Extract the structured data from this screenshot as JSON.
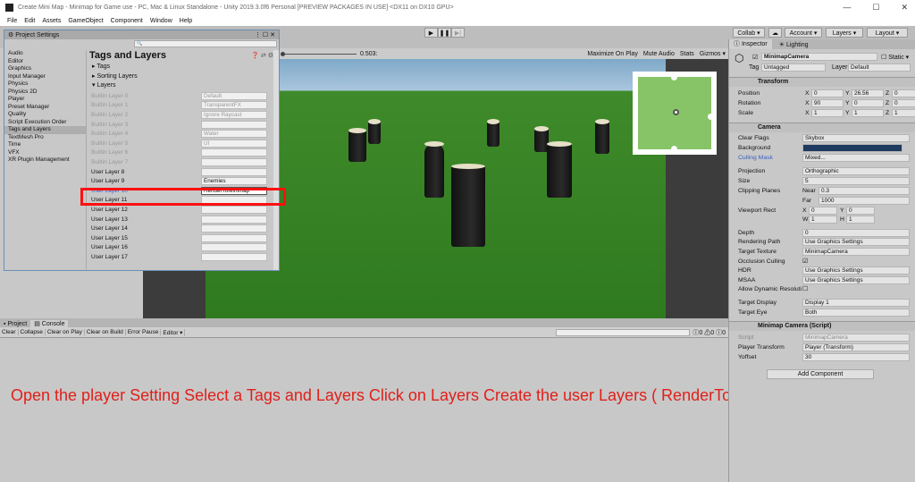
{
  "window": {
    "title": "Create Mini Map - Minimap for Game use - PC, Mac & Linux Standalone - Unity 2019.3.0f6 Personal [PREVIEW PACKAGES IN USE] <DX11 on DX10 GPU>",
    "min": "—",
    "max": "☐",
    "close": "✕"
  },
  "menu": [
    "File",
    "Edit",
    "Assets",
    "GameObject",
    "Component",
    "Window",
    "Help"
  ],
  "toolbar": {
    "play": "▶",
    "pause": "❚❚",
    "step": "▶|",
    "collab": "Collab ▾",
    "cloud": "☁",
    "account": "Account ▾",
    "layers": "Layers ▾",
    "layout": "Layout ▾"
  },
  "game": {
    "scale_value": "0.503:",
    "maximize": "Maximize On Play",
    "mute": "Mute Audio",
    "stats": "Stats",
    "gizmos": "Gizmos ▾"
  },
  "project_settings": {
    "title": "Project Settings",
    "sidebar": [
      "Audio",
      "Editor",
      "Graphics",
      "Input Manager",
      "Physics",
      "Physics 2D",
      "Player",
      "Preset Manager",
      "Quality",
      "Script Execution Order",
      "Tags and Layers",
      "TextMesh Pro",
      "Time",
      "VFX",
      "XR Plugin Management"
    ],
    "selected": "Tags and Layers",
    "heading": "Tags and Layers",
    "sections": [
      "▸ Tags",
      "▸ Sorting Layers",
      "▾ Layers"
    ],
    "layers": [
      {
        "label": "Builtin Layer 0",
        "value": "Default",
        "disabled": true
      },
      {
        "label": "Builtin Layer 1",
        "value": "TransparentFX",
        "disabled": true
      },
      {
        "label": "Builtin Layer 2",
        "value": "Ignore Raycast",
        "disabled": true
      },
      {
        "label": "Builtin Layer 3",
        "value": "",
        "disabled": true
      },
      {
        "label": "Builtin Layer 4",
        "value": "Water",
        "disabled": true
      },
      {
        "label": "Builtin Layer 5",
        "value": "UI",
        "disabled": true
      },
      {
        "label": "Builtin Layer 6",
        "value": "",
        "disabled": true
      },
      {
        "label": "Builtin Layer 7",
        "value": "",
        "disabled": true
      },
      {
        "label": "User Layer 8",
        "value": ""
      },
      {
        "label": "User Layer 9",
        "value": "Enemies"
      },
      {
        "label": "User Layer 10",
        "value": "RenderToMinimap",
        "highlight": true
      },
      {
        "label": "User Layer 11",
        "value": ""
      },
      {
        "label": "User Layer 12",
        "value": ""
      },
      {
        "label": "User Layer 13",
        "value": ""
      },
      {
        "label": "User Layer 14",
        "value": ""
      },
      {
        "label": "User Layer 15",
        "value": ""
      },
      {
        "label": "User Layer 16",
        "value": ""
      },
      {
        "label": "User Layer 17",
        "value": ""
      }
    ]
  },
  "console": {
    "tabs": [
      "Project",
      "Console"
    ],
    "buttons": [
      "Clear",
      "Collapse",
      "Clear on Play",
      "Clear on Build",
      "Error Pause",
      "Editor ▾"
    ],
    "counts": [
      "0",
      "0",
      "0"
    ]
  },
  "caption": "Open the player Setting Select a Tags and Layers  Click on Layers Create the user Layers ( RenderToMinimap )",
  "inspector": {
    "tabs": [
      "Inspector",
      "Lighting"
    ],
    "object_name": "MinimapCamera",
    "static": "Static ▾",
    "tag_label": "Tag",
    "tag": "Untagged",
    "layer_label": "Layer",
    "layer": "Default",
    "transform": {
      "title": "Transform",
      "rows": [
        {
          "label": "Position",
          "x": "0",
          "y": "26.56",
          "z": "0"
        },
        {
          "label": "Rotation",
          "x": "90",
          "y": "0",
          "z": "0"
        },
        {
          "label": "Scale",
          "x": "1",
          "y": "1",
          "z": "1"
        }
      ]
    },
    "camera": {
      "title": "Camera",
      "clear_flags": [
        "Clear Flags",
        "Skybox"
      ],
      "background": "Background",
      "background_color": "#1e3a5f",
      "culling_mask": [
        "Culling Mask",
        "Mixed..."
      ],
      "projection": [
        "Projection",
        "Orthographic"
      ],
      "size": [
        "Size",
        "5"
      ],
      "clipping": "Clipping Planes",
      "near": [
        "Near",
        "0.3"
      ],
      "far": [
        "Far",
        "1000"
      ],
      "viewport": "Viewport Rect",
      "vx": "0",
      "vy": "0",
      "vw": "1",
      "vh": "1",
      "depth": [
        "Depth",
        "0"
      ],
      "rendering_path": [
        "Rendering Path",
        "Use Graphics Settings"
      ],
      "target_texture": [
        "Target Texture",
        "MinimapCamera"
      ],
      "occlusion": "Occlusion Culling",
      "hdr": [
        "HDR",
        "Use Graphics Settings"
      ],
      "msaa": [
        "MSAA",
        "Use Graphics Settings"
      ],
      "dynres": "Allow Dynamic Resoluti",
      "target_display": [
        "Target Display",
        "Display 1"
      ],
      "target_eye": [
        "Target Eye",
        "Both"
      ]
    },
    "script": {
      "title": "Minimap Camera (Script)",
      "script": [
        "Script",
        "MinimapCamera"
      ],
      "player": [
        "Player Transform",
        "Player (Transform)"
      ],
      "yoffset": [
        "Yoffset",
        "30"
      ]
    },
    "add_component": "Add Component"
  }
}
